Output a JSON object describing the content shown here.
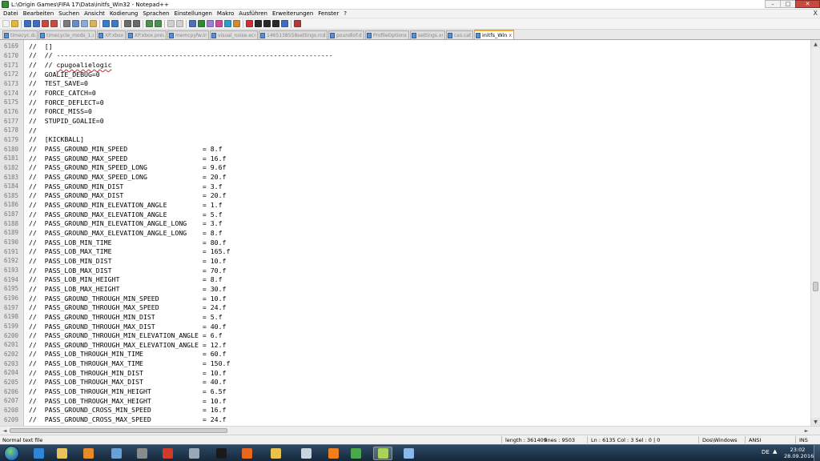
{
  "window": {
    "title": "L:\\Origin Games\\FIFA 17\\Data\\initfs_Win32 - Notepad++",
    "minimize_glyph": "–",
    "maximize_glyph": "□",
    "close_glyph": "✕"
  },
  "menu": {
    "items": [
      "Datei",
      "Bearbeiten",
      "Suchen",
      "Ansicht",
      "Kodierung",
      "Sprachen",
      "Einstellungen",
      "Makro",
      "Ausführen",
      "Erweiterungen",
      "Fenster",
      "?"
    ],
    "close_glyph": "X"
  },
  "toolbar": {
    "buttons": [
      {
        "name": "new-file",
        "color": "#f4f4f4"
      },
      {
        "name": "open-file",
        "color": "#e8b53c"
      },
      {
        "name": "save",
        "color": "#3b6fc4"
      },
      {
        "name": "save-all",
        "color": "#3b6fc4"
      },
      {
        "name": "close",
        "color": "#c94a3f"
      },
      {
        "name": "close-all",
        "color": "#c94a3f"
      },
      {
        "name": "print",
        "color": "#7a7a7a"
      },
      {
        "name": "cut",
        "color": "#6a8bc4"
      },
      {
        "name": "copy",
        "color": "#8aa8d8"
      },
      {
        "name": "paste",
        "color": "#d9b25a"
      },
      {
        "name": "undo",
        "color": "#3d7ac7"
      },
      {
        "name": "redo",
        "color": "#3d7ac7"
      },
      {
        "name": "find",
        "color": "#6a6a6a"
      },
      {
        "name": "replace",
        "color": "#6a6a6a"
      },
      {
        "name": "zoom-in",
        "color": "#4c8f4c"
      },
      {
        "name": "zoom-out",
        "color": "#4c8f4c"
      },
      {
        "name": "sync-v",
        "color": "#d0d0d0"
      },
      {
        "name": "sync-h",
        "color": "#d0d0d0"
      },
      {
        "name": "word-wrap",
        "color": "#4a6fb8"
      },
      {
        "name": "all-chars",
        "color": "#2f8a2f"
      },
      {
        "name": "indent-guide",
        "color": "#9c7fd0"
      },
      {
        "name": "udl",
        "color": "#d04a9c"
      },
      {
        "name": "doc-map",
        "color": "#2f9ad0"
      },
      {
        "name": "function-list",
        "color": "#d08a2f"
      },
      {
        "name": "record-macro",
        "color": "#d02f2f"
      },
      {
        "name": "stop-macro",
        "color": "#2a2a2a"
      },
      {
        "name": "play-macro",
        "color": "#2a2a2a"
      },
      {
        "name": "play-macro-multiple",
        "color": "#2a2a2a"
      },
      {
        "name": "save-macro",
        "color": "#3b6fc4"
      },
      {
        "name": "abc-spellcheck",
        "color": "#b43a3a"
      }
    ]
  },
  "tabs": [
    {
      "label": "timecyc.dat",
      "active": false
    },
    {
      "label": "timecycle_mods_1.xml",
      "active": false
    },
    {
      "label": "XP.xbox",
      "active": false
    },
    {
      "label": "XP.xbox.prev",
      "active": false
    },
    {
      "label": "memcpyfw.ini",
      "active": false
    },
    {
      "label": "visual_noise.ecr",
      "active": false
    },
    {
      "label": "1465138558settings.rcdr",
      "active": false
    },
    {
      "label": "poundlof.dll",
      "active": false
    },
    {
      "label": "ProfileOptions",
      "active": false
    },
    {
      "label": "settings.xml",
      "active": false
    },
    {
      "label": "cas.cat",
      "active": false
    },
    {
      "label": "initfs_Win32",
      "active": true
    }
  ],
  "tab_close_glyph": "x",
  "editor": {
    "lines": [
      {
        "num": "6169",
        "text": "//  []"
      },
      {
        "num": "6170",
        "text": "//  // ----------------------------------------------------------------------"
      },
      {
        "num": "6171",
        "prefix": "//  // ",
        "text": "cpugoalielogic",
        "misspelled": true
      },
      {
        "num": "6172",
        "text": "//  GOALIE_DEBUG=0"
      },
      {
        "num": "6173",
        "text": "//  TEST_SAVE=0"
      },
      {
        "num": "6174",
        "text": "//  FORCE_CATCH=0"
      },
      {
        "num": "6175",
        "text": "//  FORCE_DEFLECT=0"
      },
      {
        "num": "6176",
        "text": "//  FORCE_MISS=0"
      },
      {
        "num": "6177",
        "text": "//  STUPID_GOALIE=0"
      },
      {
        "num": "6178",
        "text": "//"
      },
      {
        "num": "6179",
        "text": "//  [KICKBALL]"
      },
      {
        "num": "6180",
        "text": "//  PASS_GROUND_MIN_SPEED                   = 8.f"
      },
      {
        "num": "6181",
        "text": "//  PASS_GROUND_MAX_SPEED                   = 16.f"
      },
      {
        "num": "6182",
        "text": "//  PASS_GROUND_MIN_SPEED_LONG              = 9.6f"
      },
      {
        "num": "6183",
        "text": "//  PASS_GROUND_MAX_SPEED_LONG              = 20.f"
      },
      {
        "num": "6184",
        "text": "//  PASS_GROUND_MIN_DIST                    = 3.f"
      },
      {
        "num": "6185",
        "text": "//  PASS_GROUND_MAX_DIST                    = 20.f"
      },
      {
        "num": "6186",
        "text": "//  PASS_GROUND_MIN_ELEVATION_ANGLE         = 1.f"
      },
      {
        "num": "6187",
        "text": "//  PASS_GROUND_MAX_ELEVATION_ANGLE         = 5.f"
      },
      {
        "num": "6188",
        "text": "//  PASS_GROUND_MIN_ELEVATION_ANGLE_LONG    = 3.f"
      },
      {
        "num": "6189",
        "text": "//  PASS_GROUND_MAX_ELEVATION_ANGLE_LONG    = 8.f"
      },
      {
        "num": "6190",
        "text": "//  PASS_LOB_MIN_TIME                       = 80.f"
      },
      {
        "num": "6191",
        "text": "//  PASS_LOB_MAX_TIME                       = 165.f"
      },
      {
        "num": "6192",
        "text": "//  PASS_LOB_MIN_DIST                       = 10.f"
      },
      {
        "num": "6193",
        "text": "//  PASS_LOB_MAX_DIST                       = 70.f"
      },
      {
        "num": "6194",
        "text": "//  PASS_LOB_MIN_HEIGHT                     = 8.f"
      },
      {
        "num": "6195",
        "text": "//  PASS_LOB_MAX_HEIGHT                     = 30.f"
      },
      {
        "num": "6196",
        "text": "//  PASS_GROUND_THROUGH_MIN_SPEED           = 10.f"
      },
      {
        "num": "6197",
        "text": "//  PASS_GROUND_THROUGH_MAX_SPEED           = 24.f"
      },
      {
        "num": "6198",
        "text": "//  PASS_GROUND_THROUGH_MIN_DIST            = 5.f"
      },
      {
        "num": "6199",
        "text": "//  PASS_GROUND_THROUGH_MAX_DIST            = 40.f"
      },
      {
        "num": "6200",
        "text": "//  PASS_GROUND_THROUGH_MIN_ELEVATION_ANGLE = 6.f"
      },
      {
        "num": "6201",
        "text": "//  PASS_GROUND_THROUGH_MAX_ELEVATION_ANGLE = 12.f"
      },
      {
        "num": "6202",
        "text": "//  PASS_LOB_THROUGH_MIN_TIME               = 60.f"
      },
      {
        "num": "6203",
        "text": "//  PASS_LOB_THROUGH_MAX_TIME               = 150.f"
      },
      {
        "num": "6204",
        "text": "//  PASS_LOB_THROUGH_MIN_DIST               = 10.f"
      },
      {
        "num": "6205",
        "text": "//  PASS_LOB_THROUGH_MAX_DIST               = 40.f"
      },
      {
        "num": "6206",
        "text": "//  PASS_LOB_THROUGH_MIN_HEIGHT             = 6.5f"
      },
      {
        "num": "6207",
        "text": "//  PASS_LOB_THROUGH_MAX_HEIGHT             = 10.f"
      },
      {
        "num": "6208",
        "text": "//  PASS_GROUND_CROSS_MIN_SPEED             = 16.f"
      },
      {
        "num": "6209",
        "text": "//  PASS_GROUND_CROSS_MAX_SPEED             = 24.f"
      }
    ]
  },
  "scrollbar": {
    "up_glyph": "▲",
    "down_glyph": "▼",
    "left_glyph": "◄",
    "right_glyph": "►"
  },
  "status": {
    "file_type": "Normal text file",
    "length": "length : 361409",
    "lines": "lines : 9503",
    "position": "Ln : 6135    Col : 3    Sel : 0 | 0",
    "eol": "Dos\\Windows",
    "encoding": "ANSI",
    "mode": "INS"
  },
  "taskbar": {
    "apps": [
      {
        "name": "internet-explorer",
        "color": "#2f86d6",
        "active": false
      },
      {
        "name": "file-explorer",
        "color": "#e9c25a",
        "active": false
      },
      {
        "name": "media-player",
        "color": "#e88a2a",
        "active": false
      },
      {
        "name": "network",
        "color": "#6aa0d8",
        "active": false
      },
      {
        "name": "origin-games",
        "color": "#8a8a8a",
        "active": false
      },
      {
        "name": "chrome",
        "color": "#d23a2a",
        "active": false
      },
      {
        "name": "virtualbox",
        "color": "#9aa8b8",
        "active": false
      },
      {
        "name": "gamepad",
        "color": "#1a1a1a",
        "active": false
      },
      {
        "name": "firefox",
        "color": "#e8661e",
        "active": false
      },
      {
        "name": "folder",
        "color": "#e8c24a",
        "active": false
      },
      {
        "name": "scanner",
        "color": "#c8d4e0",
        "active": false
      },
      {
        "name": "origin",
        "color": "#f07e1a",
        "active": false
      },
      {
        "name": "green-app",
        "color": "#4aa84a",
        "active": false
      },
      {
        "name": "notepad-plus-plus",
        "color": "#a8d45a",
        "active": true
      },
      {
        "name": "paint",
        "color": "#8ab8e8",
        "active": false
      }
    ],
    "language": "DE",
    "tray_arrow": "▲",
    "time": "23:02",
    "date": "28.09.2016"
  }
}
